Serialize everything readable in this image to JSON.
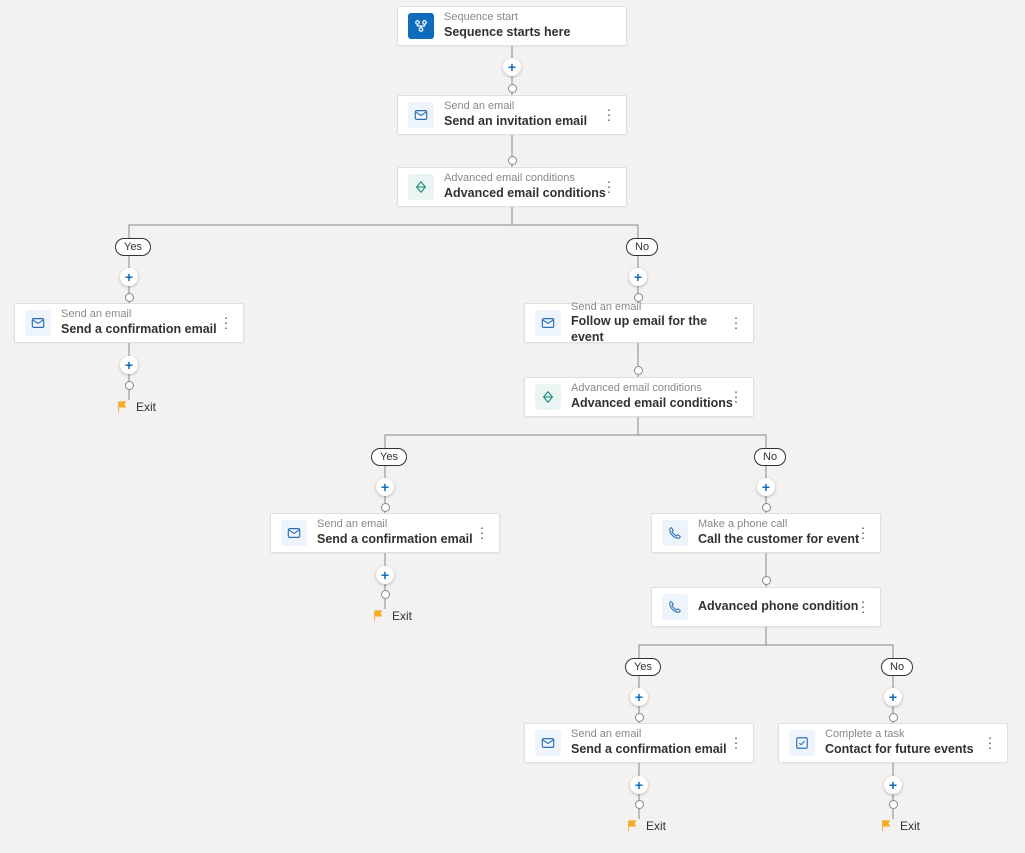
{
  "labels": {
    "yes": "Yes",
    "no": "No",
    "exit": "Exit"
  },
  "colors": {
    "accent": "#0f6cbd",
    "flag": "#f7a928",
    "line": "#8a8886"
  },
  "nodes": {
    "start": {
      "sub": "Sequence start",
      "title": "Sequence starts here"
    },
    "email1": {
      "sub": "Send an email",
      "title": "Send an invitation email"
    },
    "cond1": {
      "sub": "Advanced email conditions",
      "title": "Advanced email conditions"
    },
    "yes1": {
      "sub": "Send an email",
      "title": "Send a confirmation email"
    },
    "no1": {
      "sub": "Send an email",
      "title": "Follow up email for the event"
    },
    "cond2": {
      "sub": "Advanced email conditions",
      "title": "Advanced email conditions"
    },
    "yes2": {
      "sub": "Send an email",
      "title": "Send a confirmation email"
    },
    "no2": {
      "sub": "Make a phone call",
      "title": "Call the customer for event"
    },
    "cond3": {
      "sub": "",
      "title": "Advanced phone condition"
    },
    "yes3": {
      "sub": "Send an email",
      "title": "Send a confirmation email"
    },
    "no3": {
      "sub": "Complete a task",
      "title": "Contact for future events"
    }
  }
}
